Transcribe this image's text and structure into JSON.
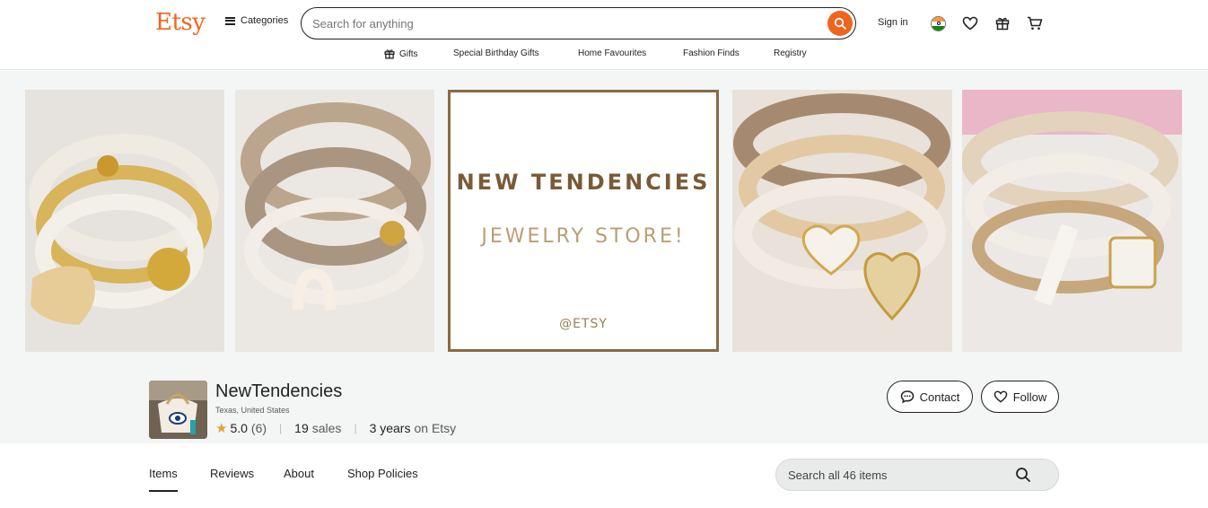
{
  "header": {
    "logo": "Etsy",
    "categories_label": "Categories",
    "search_placeholder": "Search for anything",
    "signin_label": "Sign in",
    "brand_color": "#f1641e"
  },
  "subnav": {
    "items": [
      "Gifts",
      "Special Birthday Gifts",
      "Home Favourites",
      "Fashion Finds",
      "Registry"
    ]
  },
  "banner": {
    "title": "NEW TENDENCIES",
    "subtitle": "JEWELRY STORE!",
    "watermark": "@ETSY"
  },
  "shop": {
    "name": "NewTendencies",
    "location": "Texas, United States",
    "rating": "5.0",
    "review_count": "(6)",
    "sales_count": "19",
    "sales_label": "sales",
    "years": "3 years",
    "years_label": "on Etsy",
    "contact_label": "Contact",
    "follow_label": "Follow"
  },
  "tabs": {
    "items": [
      "Items",
      "Reviews",
      "About",
      "Shop Policies"
    ],
    "active": "Items",
    "search_placeholder": "Search all 46 items"
  }
}
